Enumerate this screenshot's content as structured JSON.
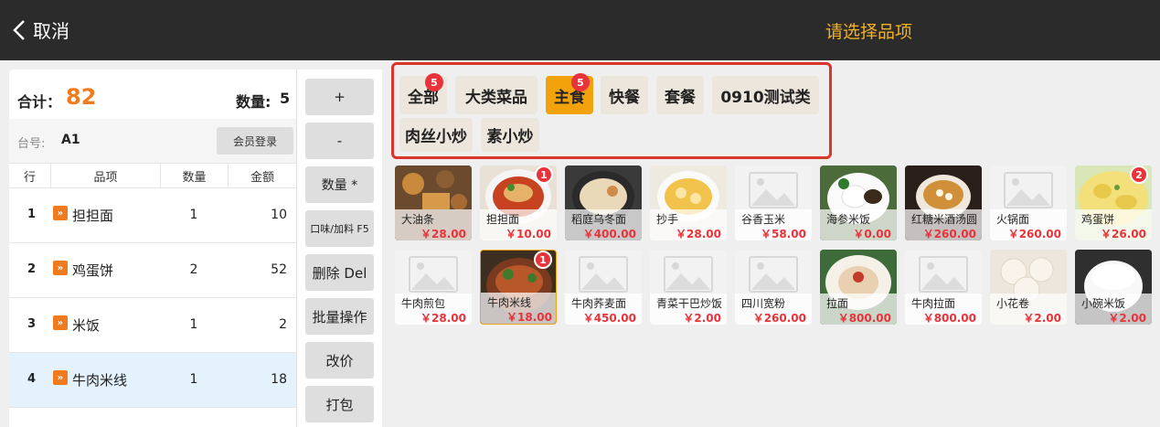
{
  "header": {
    "back_label": "取消",
    "title": "请选择品项"
  },
  "summary": {
    "total_label": "合计：",
    "total_value": "82",
    "qty_label": "数量:",
    "qty_value": "5"
  },
  "table_info": {
    "label": "台号:",
    "value": "A1",
    "member_button": "会员登录"
  },
  "order_columns": [
    "行",
    "品项",
    "数量",
    "金额"
  ],
  "order_rows": [
    {
      "idx": "1",
      "tag": "»",
      "name": "担担面",
      "qty": "1",
      "amount": "10"
    },
    {
      "idx": "2",
      "tag": "»",
      "name": "鸡蛋饼",
      "qty": "2",
      "amount": "52"
    },
    {
      "idx": "3",
      "tag": "»",
      "name": "米饭",
      "qty": "1",
      "amount": "2"
    },
    {
      "idx": "4",
      "tag": "»",
      "name": "牛肉米线",
      "qty": "1",
      "amount": "18"
    }
  ],
  "actions": [
    "+",
    "-",
    "数量 *",
    "口味/加料 F5",
    "删除 Del",
    "批量操作",
    "改价",
    "打包"
  ],
  "categories": [
    {
      "label": "全部",
      "badge": "5"
    },
    {
      "label": "大类菜品",
      "badge": ""
    },
    {
      "label": "主食",
      "badge": "5"
    },
    {
      "label": "快餐",
      "badge": ""
    },
    {
      "label": "套餐",
      "badge": ""
    },
    {
      "label": "0910测试类",
      "badge": ""
    },
    {
      "label": "肉丝小炒",
      "badge": ""
    },
    {
      "label": "素小炒",
      "badge": ""
    }
  ],
  "products": [
    {
      "name": "大油条",
      "price": "￥28.00",
      "badge": "",
      "image": "photo-fried-dough"
    },
    {
      "name": "担担面",
      "price": "￥10.00",
      "badge": "1",
      "image": "photo-noodles-red"
    },
    {
      "name": "稻庭乌冬面",
      "price": "￥400.00",
      "badge": "",
      "image": "photo-udon"
    },
    {
      "name": "抄手",
      "price": "￥28.00",
      "badge": "",
      "image": "photo-wonton"
    },
    {
      "name": "谷香玉米",
      "price": "￥58.00",
      "badge": "",
      "image": "placeholder"
    },
    {
      "name": "海参米饭",
      "price": "￥0.00",
      "badge": "",
      "image": "photo-rice-plate"
    },
    {
      "name": "红糖米酒汤圆",
      "price": "￥260.00",
      "badge": "",
      "image": "photo-soup-bowl"
    },
    {
      "name": "火锅面",
      "price": "￥260.00",
      "badge": "",
      "image": "placeholder"
    },
    {
      "name": "鸡蛋饼",
      "price": "￥26.00",
      "badge": "2",
      "image": "photo-egg-pancake"
    },
    {
      "name": "牛肉煎包",
      "price": "￥28.00",
      "badge": "",
      "image": "placeholder"
    },
    {
      "name": "牛肉米线",
      "price": "￥18.00",
      "badge": "1",
      "image": "photo-beef-noodle"
    },
    {
      "name": "牛肉荞麦面",
      "price": "￥450.00",
      "badge": "",
      "image": "placeholder"
    },
    {
      "name": "青菜干巴炒饭",
      "price": "￥2.00",
      "badge": "",
      "image": "placeholder"
    },
    {
      "name": "四川宽粉",
      "price": "￥260.00",
      "badge": "",
      "image": "placeholder"
    },
    {
      "name": "拉面",
      "price": "￥800.00",
      "badge": "",
      "image": "photo-ramen-plate"
    },
    {
      "name": "牛肉拉面",
      "price": "￥800.00",
      "badge": "",
      "image": "placeholder"
    },
    {
      "name": "小花卷",
      "price": "￥2.00",
      "badge": "",
      "image": "photo-buns"
    },
    {
      "name": "小碗米饭",
      "price": "￥2.00",
      "badge": "",
      "image": "photo-rice-bowl"
    }
  ],
  "colors": {
    "accent": "#f2a20c",
    "badge": "#e8333a",
    "total": "#f07b1e",
    "title": "#f3b124",
    "highlight_border": "#d9372b"
  }
}
